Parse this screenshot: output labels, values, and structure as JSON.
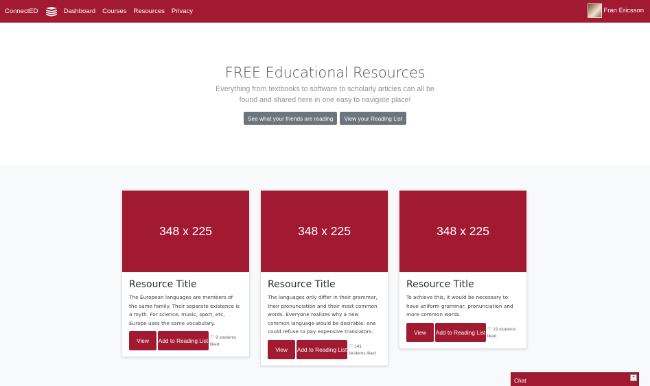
{
  "navbar": {
    "brand": "ConnectED",
    "links": [
      "Dashboard",
      "Courses",
      "Resources",
      "Privacy"
    ],
    "user_name": "Fran Ericsson"
  },
  "hero": {
    "title": "FREE Educational Resources",
    "lead": "Everything from textbooks to software to scholarly articles can all be found and shared here in one easy to navigate place!",
    "buttons": [
      "See what your friends are reading",
      "View your Reading List"
    ]
  },
  "cards": [
    {
      "image_label": "348 x 225",
      "title": "Resource Title",
      "text": "The European languages are members of the same family. Their separate existence is a myth. For science, music, sport, etc, Europe uses the same vocabulary.",
      "view_label": "View",
      "add_label": "Add to Reading List",
      "likes": "9 students liked"
    },
    {
      "image_label": "348 x 225",
      "title": "Resource Title",
      "text": "The languages only differ in their grammar, their pronunciation and their most common words. Everyone realizes why a new common language would be desirable: one could refuse to pay expensive translators.",
      "view_label": "View",
      "add_label": "Add to Reading List",
      "likes": "141 students liked"
    },
    {
      "image_label": "348 x 225",
      "title": "Resource Title",
      "text": "To achieve this, it would be necessary to have uniform grammar, pronunciation and more common words.",
      "view_label": "View",
      "add_label": "Add to Reading List",
      "likes": "19 students liked"
    }
  ],
  "chat": {
    "label": "Chat",
    "toggle": "+"
  },
  "colors": {
    "brand": "#a21a32",
    "secondary": "#6c757d",
    "album_bg": "#f8f9fa"
  },
  "icons": [
    "books-icon",
    "heart-icon",
    "avatar-image"
  ]
}
